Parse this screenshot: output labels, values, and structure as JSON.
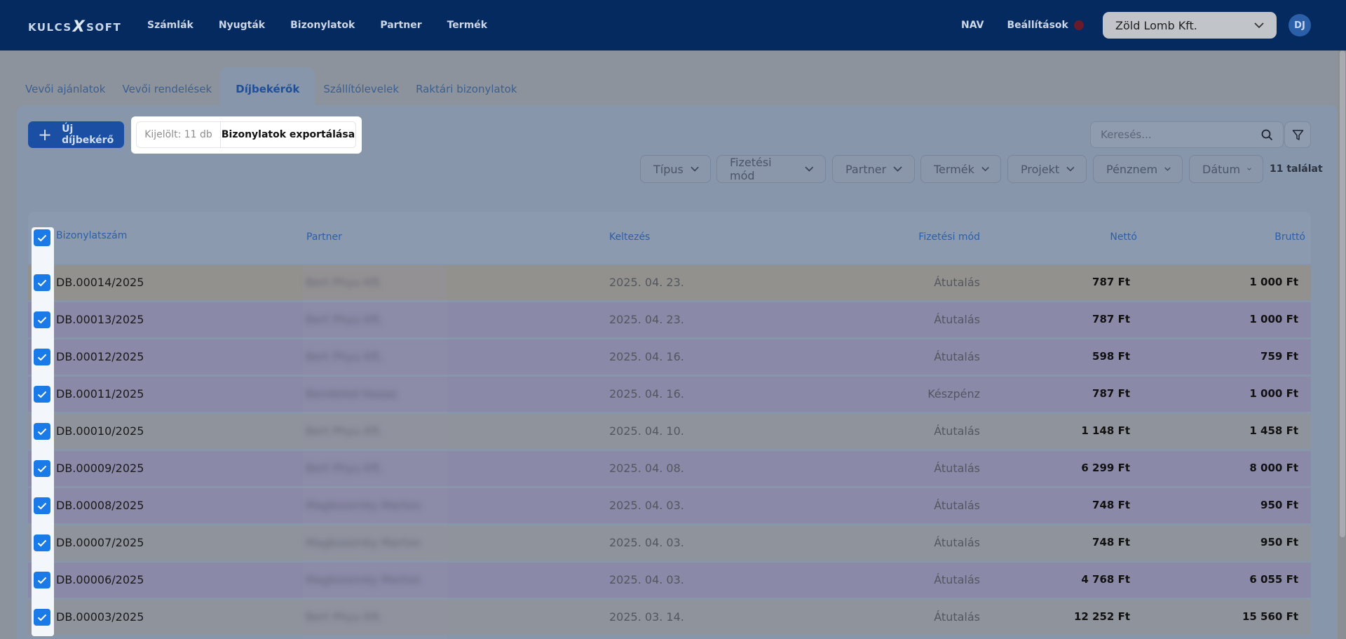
{
  "brand": {
    "logo_left": "KULCS",
    "logo_x": "X",
    "logo_right": "SOFT"
  },
  "nav": {
    "items": [
      "Számlák",
      "Nyugták",
      "Bizonylatok",
      "Partner",
      "Termék"
    ],
    "right_items": [
      "NAV",
      "Beállítások"
    ],
    "company": "Zöld Lomb Kft.",
    "avatar": "DJ"
  },
  "tabs": [
    "Vevői ajánlatok",
    "Vevői rendelések",
    "Díjbekérők",
    "Szállítólevelek",
    "Raktári bizonylatok"
  ],
  "toolbar": {
    "new_label": "Új díjbekérő",
    "selected_label": "Kijelölt: 11 db",
    "export_label": "Bizonylatok exportálása",
    "search_placeholder": "Keresés...",
    "hits": "11 találat"
  },
  "filters": [
    "Típus",
    "Fizetési mód",
    "Partner",
    "Termék",
    "Projekt",
    "Pénznem",
    "Dátum"
  ],
  "table": {
    "headers": [
      "Bizonylatszám",
      "Partner",
      "Keltezés",
      "Fizetési mód",
      "Nettó",
      "Bruttó"
    ],
    "rows": [
      {
        "num": "DB.00014/2025",
        "partner": "Bert Phyu Kft.",
        "date": "2025. 04. 23.",
        "pay": "Átutalás",
        "net": "787 Ft",
        "gross": "1 000 Ft",
        "tone": "gray"
      },
      {
        "num": "DB.00013/2025",
        "partner": "Bert Phyu Kft.",
        "date": "2025. 04. 23.",
        "pay": "Átutalás",
        "net": "787 Ft",
        "gross": "1 000 Ft",
        "tone": "purple"
      },
      {
        "num": "DB.00012/2025",
        "partner": "Bert Phyu Kft.",
        "date": "2025. 04. 16.",
        "pay": "Átutalás",
        "net": "598 Ft",
        "gross": "759 Ft",
        "tone": "purple"
      },
      {
        "num": "DB.00011/2025",
        "partner": "Bendeled Haaas",
        "date": "2025. 04. 16.",
        "pay": "Készpénz",
        "net": "787 Ft",
        "gross": "1 000 Ft",
        "tone": "purple"
      },
      {
        "num": "DB.00010/2025",
        "partner": "Bert Phyu Kft.",
        "date": "2025. 04. 10.",
        "pay": "Átutalás",
        "net": "1 148 Ft",
        "gross": "1 458 Ft",
        "tone": "light"
      },
      {
        "num": "DB.00009/2025",
        "partner": "Bert Phyu Kft.",
        "date": "2025. 04. 08.",
        "pay": "Átutalás",
        "net": "6 299 Ft",
        "gross": "8 000 Ft",
        "tone": "purple"
      },
      {
        "num": "DB.00008/2025",
        "partner": "Magkossmky Marton",
        "date": "2025. 04. 03.",
        "pay": "Átutalás",
        "net": "748 Ft",
        "gross": "950 Ft",
        "tone": "purple"
      },
      {
        "num": "DB.00007/2025",
        "partner": "Magkossmky Marton",
        "date": "2025. 04. 03.",
        "pay": "Átutalás",
        "net": "748 Ft",
        "gross": "950 Ft",
        "tone": "light"
      },
      {
        "num": "DB.00006/2025",
        "partner": "Magkossmky Marton",
        "date": "2025. 04. 03.",
        "pay": "Átutalás",
        "net": "4 768 Ft",
        "gross": "6 055 Ft",
        "tone": "purple"
      },
      {
        "num": "DB.00003/2025",
        "partner": "Bert Phyu Kft.",
        "date": "2025. 03. 14.",
        "pay": "Átutalás",
        "net": "12 252 Ft",
        "gross": "15 560 Ft",
        "tone": "light"
      }
    ]
  }
}
